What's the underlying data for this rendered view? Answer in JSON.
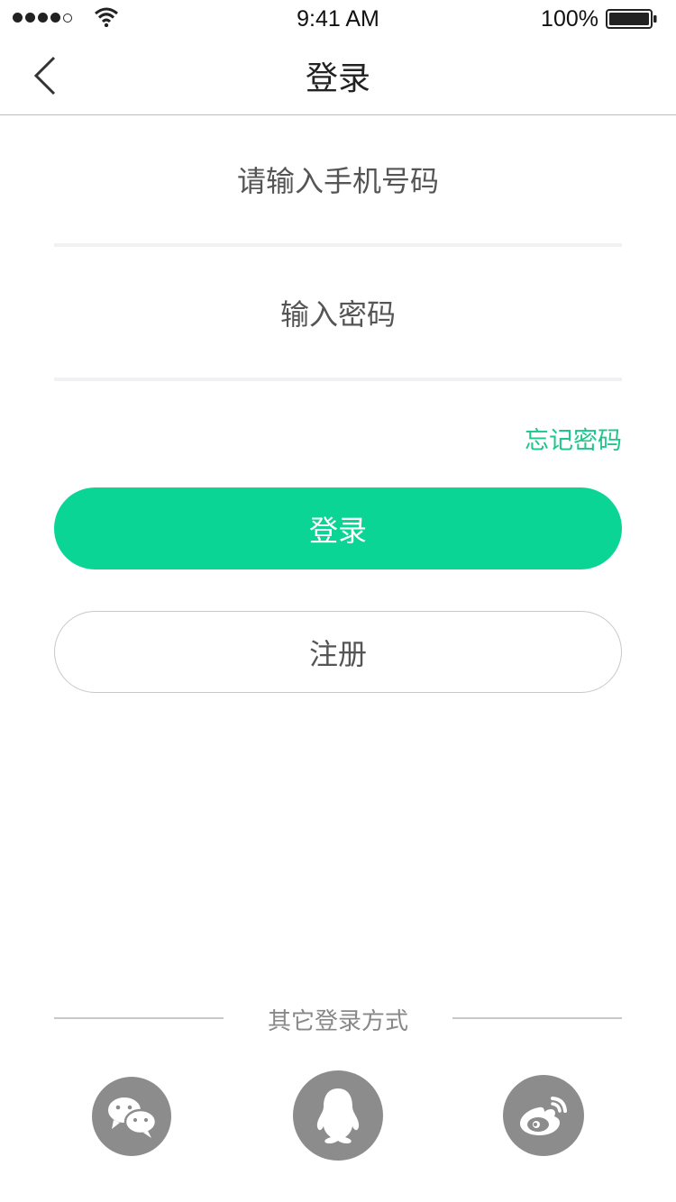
{
  "status_bar": {
    "time": "9:41 AM",
    "battery": "100%",
    "signal_icon": "signal-dots-icon",
    "wifi_icon": "wifi-icon",
    "battery_icon": "battery-full-icon"
  },
  "nav": {
    "title": "登录",
    "back_icon": "chevron-left-icon"
  },
  "form": {
    "phone_placeholder": "请输入手机号码",
    "phone_value": "",
    "password_placeholder": "输入密码",
    "password_value": "",
    "forgot_label": "忘记密码",
    "login_label": "登录",
    "register_label": "注册"
  },
  "other_login": {
    "label": "其它登录方式",
    "providers": [
      {
        "icon": "wechat-icon"
      },
      {
        "icon": "qq-icon"
      },
      {
        "icon": "weibo-icon"
      }
    ]
  },
  "colors": {
    "accent": "#0bd594",
    "link": "#1ec68b",
    "social_bg": "#8c8c8c"
  }
}
